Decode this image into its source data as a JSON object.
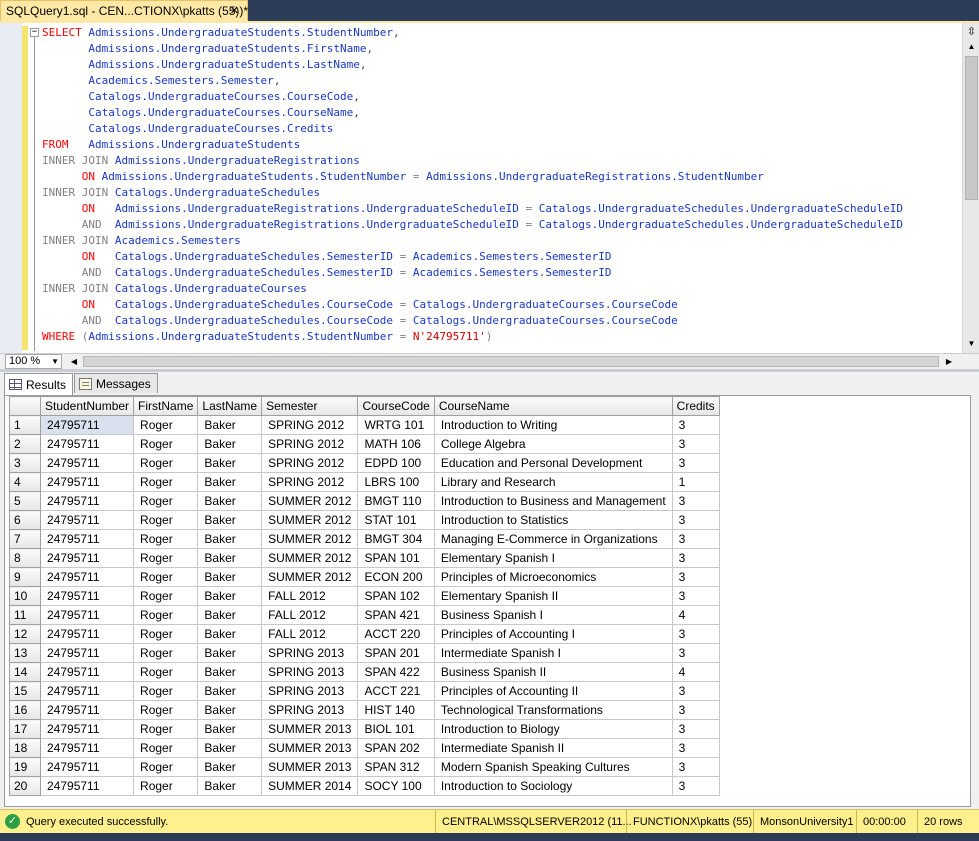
{
  "tab": {
    "title": "SQLQuery1.sql - CEN...CTIONX\\pkatts (55))*",
    "close": "✕"
  },
  "editor": {
    "lines": [
      [
        {
          "c": "kw",
          "t": "SELECT"
        },
        {
          "c": "id",
          "t": " Admissions.UndergraduateStudents.StudentNumber"
        },
        {
          "c": "blk",
          "t": ","
        }
      ],
      [
        {
          "c": "id",
          "t": "       Admissions.UndergraduateStudents.FirstName"
        },
        {
          "c": "blk",
          "t": ","
        }
      ],
      [
        {
          "c": "id",
          "t": "       Admissions.UndergraduateStudents.LastName"
        },
        {
          "c": "blk",
          "t": ","
        }
      ],
      [
        {
          "c": "id",
          "t": "       Academics.Semesters.Semester"
        },
        {
          "c": "blk",
          "t": ","
        }
      ],
      [
        {
          "c": "id",
          "t": "       Catalogs.UndergraduateCourses.CourseCode"
        },
        {
          "c": "blk",
          "t": ","
        }
      ],
      [
        {
          "c": "id",
          "t": "       Catalogs.UndergraduateCourses.CourseName"
        },
        {
          "c": "blk",
          "t": ","
        }
      ],
      [
        {
          "c": "id",
          "t": "       Catalogs.UndergraduateCourses.Credits"
        }
      ],
      [
        {
          "c": "kw",
          "t": "FROM"
        },
        {
          "c": "id",
          "t": "   Admissions.UndergraduateStudents"
        }
      ],
      [
        {
          "c": "gray",
          "t": "INNER JOIN"
        },
        {
          "c": "id",
          "t": " Admissions.UndergraduateRegistrations"
        }
      ],
      [
        {
          "c": "kw",
          "t": "      ON"
        },
        {
          "c": "id",
          "t": " Admissions.UndergraduateStudents.StudentNumber "
        },
        {
          "c": "gray",
          "t": "="
        },
        {
          "c": "id",
          "t": " Admissions.UndergraduateRegistrations.StudentNumber"
        }
      ],
      [
        {
          "c": "gray",
          "t": "INNER JOIN"
        },
        {
          "c": "id",
          "t": " Catalogs.UndergraduateSchedules"
        }
      ],
      [
        {
          "c": "kw",
          "t": "      ON"
        },
        {
          "c": "id",
          "t": "   Admissions.UndergraduateRegistrations.UndergraduateScheduleID "
        },
        {
          "c": "gray",
          "t": "="
        },
        {
          "c": "id",
          "t": " Catalogs.UndergraduateSchedules.UndergraduateScheduleID"
        }
      ],
      [
        {
          "c": "gray",
          "t": "      AND"
        },
        {
          "c": "id",
          "t": "  Admissions.UndergraduateRegistrations.UndergraduateScheduleID "
        },
        {
          "c": "gray",
          "t": "="
        },
        {
          "c": "id",
          "t": " Catalogs.UndergraduateSchedules.UndergraduateScheduleID"
        }
      ],
      [
        {
          "c": "gray",
          "t": "INNER JOIN"
        },
        {
          "c": "id",
          "t": " Academics.Semesters"
        }
      ],
      [
        {
          "c": "kw",
          "t": "      ON"
        },
        {
          "c": "id",
          "t": "   Catalogs.UndergraduateSchedules.SemesterID "
        },
        {
          "c": "gray",
          "t": "="
        },
        {
          "c": "id",
          "t": " Academics.Semesters.SemesterID"
        }
      ],
      [
        {
          "c": "gray",
          "t": "      AND"
        },
        {
          "c": "id",
          "t": "  Catalogs.UndergraduateSchedules.SemesterID "
        },
        {
          "c": "gray",
          "t": "="
        },
        {
          "c": "id",
          "t": " Academics.Semesters.SemesterID"
        }
      ],
      [
        {
          "c": "gray",
          "t": "INNER JOIN"
        },
        {
          "c": "id",
          "t": " Catalogs.UndergraduateCourses"
        }
      ],
      [
        {
          "c": "kw",
          "t": "      ON"
        },
        {
          "c": "id",
          "t": "   Catalogs.UndergraduateSchedules.CourseCode "
        },
        {
          "c": "gray",
          "t": "="
        },
        {
          "c": "id",
          "t": " Catalogs.UndergraduateCourses.CourseCode"
        }
      ],
      [
        {
          "c": "gray",
          "t": "      AND"
        },
        {
          "c": "id",
          "t": "  Catalogs.UndergraduateSchedules.CourseCode "
        },
        {
          "c": "gray",
          "t": "="
        },
        {
          "c": "id",
          "t": " Catalogs.UndergraduateCourses.CourseCode"
        }
      ],
      [
        {
          "c": "kw",
          "t": "WHERE"
        },
        {
          "c": "gray",
          "t": " ("
        },
        {
          "c": "id",
          "t": "Admissions.UndergraduateStudents.StudentNumber "
        },
        {
          "c": "gray",
          "t": "="
        },
        {
          "c": "str",
          "t": " N'24795711'"
        },
        {
          "c": "gray",
          "t": ")"
        }
      ]
    ]
  },
  "zoom": {
    "value": "100 %"
  },
  "results_tabs": [
    {
      "label": "Results"
    },
    {
      "label": "Messages"
    }
  ],
  "grid": {
    "columns": [
      "StudentNumber",
      "FirstName",
      "LastName",
      "Semester",
      "CourseCode",
      "CourseName",
      "Credits"
    ],
    "rows": [
      [
        "1",
        "24795711",
        "Roger",
        "Baker",
        "SPRING 2012",
        "WRTG 101",
        "Introduction to Writing",
        "3"
      ],
      [
        "2",
        "24795711",
        "Roger",
        "Baker",
        "SPRING 2012",
        "MATH 106",
        "College Algebra",
        "3"
      ],
      [
        "3",
        "24795711",
        "Roger",
        "Baker",
        "SPRING 2012",
        "EDPD 100",
        "Education and Personal Development",
        "3"
      ],
      [
        "4",
        "24795711",
        "Roger",
        "Baker",
        "SPRING 2012",
        "LBRS 100",
        "Library and Research",
        "1"
      ],
      [
        "5",
        "24795711",
        "Roger",
        "Baker",
        "SUMMER 2012",
        "BMGT 110",
        "Introduction to Business and Management",
        "3"
      ],
      [
        "6",
        "24795711",
        "Roger",
        "Baker",
        "SUMMER 2012",
        "STAT 101",
        "Introduction to Statistics",
        "3"
      ],
      [
        "7",
        "24795711",
        "Roger",
        "Baker",
        "SUMMER 2012",
        "BMGT 304",
        "Managing E-Commerce in Organizations",
        "3"
      ],
      [
        "8",
        "24795711",
        "Roger",
        "Baker",
        "SUMMER 2012",
        "SPAN 101",
        "Elementary Spanish I",
        "3"
      ],
      [
        "9",
        "24795711",
        "Roger",
        "Baker",
        "SUMMER 2012",
        "ECON 200",
        "Principles of Microeconomics",
        "3"
      ],
      [
        "10",
        "24795711",
        "Roger",
        "Baker",
        "FALL 2012",
        "SPAN 102",
        "Elementary Spanish II",
        "3"
      ],
      [
        "11",
        "24795711",
        "Roger",
        "Baker",
        "FALL 2012",
        "SPAN 421",
        "Business Spanish I",
        "4"
      ],
      [
        "12",
        "24795711",
        "Roger",
        "Baker",
        "FALL 2012",
        "ACCT 220",
        "Principles of Accounting I",
        "3"
      ],
      [
        "13",
        "24795711",
        "Roger",
        "Baker",
        "SPRING 2013",
        "SPAN 201",
        "Intermediate Spanish I",
        "3"
      ],
      [
        "14",
        "24795711",
        "Roger",
        "Baker",
        "SPRING 2013",
        "SPAN 422",
        "Business Spanish II",
        "4"
      ],
      [
        "15",
        "24795711",
        "Roger",
        "Baker",
        "SPRING 2013",
        "ACCT 221",
        "Principles of Accounting II",
        "3"
      ],
      [
        "16",
        "24795711",
        "Roger",
        "Baker",
        "SPRING 2013",
        "HIST 140",
        "Technological Transformations",
        "3"
      ],
      [
        "17",
        "24795711",
        "Roger",
        "Baker",
        "SUMMER 2013",
        "BIOL 101",
        "Introduction to Biology",
        "3"
      ],
      [
        "18",
        "24795711",
        "Roger",
        "Baker",
        "SUMMER 2013",
        "SPAN 202",
        "Intermediate Spanish II",
        "3"
      ],
      [
        "19",
        "24795711",
        "Roger",
        "Baker",
        "SUMMER 2013",
        "SPAN 312",
        "Modern Spanish Speaking Cultures",
        "3"
      ],
      [
        "20",
        "24795711",
        "Roger",
        "Baker",
        "SUMMER 2014",
        "SOCY 100",
        "Introduction to Sociology",
        "3"
      ]
    ]
  },
  "status": {
    "message": "Query executed successfully.",
    "server": "CENTRAL\\MSSQLSERVER2012 (11...",
    "user": "FUNCTIONX\\pkatts (55)",
    "database": "MonsonUniversity1",
    "elapsed": "00:00:00",
    "rows": "20 rows"
  },
  "colors": {
    "accent": "#ffe8a6",
    "status": "#fff08e",
    "keyword": "#ff0000",
    "identifier": "#1838bd",
    "frame": "#2b3c59"
  }
}
